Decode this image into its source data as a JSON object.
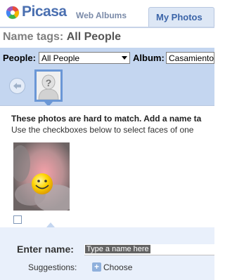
{
  "header": {
    "logo_text": "Picasa",
    "logo_sub": "Web Albums",
    "tab_label": "My Photos"
  },
  "page": {
    "title_prefix": "Name tags:",
    "title_value": "All People"
  },
  "filters": {
    "people_label": "People:",
    "people_value": "All People",
    "album_label": "Album:",
    "album_value": "Casamiento"
  },
  "content": {
    "info_line1": "These photos are hard to match. Add a name ta",
    "info_line2": "Use the checkboxes below to select faces of one",
    "enter_name_label": "Enter name:",
    "name_placeholder": "Type a name here",
    "suggestions_label": "Suggestions:",
    "choose_label": "Choose"
  },
  "colors": {
    "accent": "#4a6fb0",
    "bar": "#c4d6f0",
    "selected": "#6a97d6"
  },
  "icons": {
    "logo": "picasa-logo-icon",
    "back": "back-arrow-icon",
    "unknown_face": "unknown-person-icon",
    "add": "plus-icon"
  }
}
